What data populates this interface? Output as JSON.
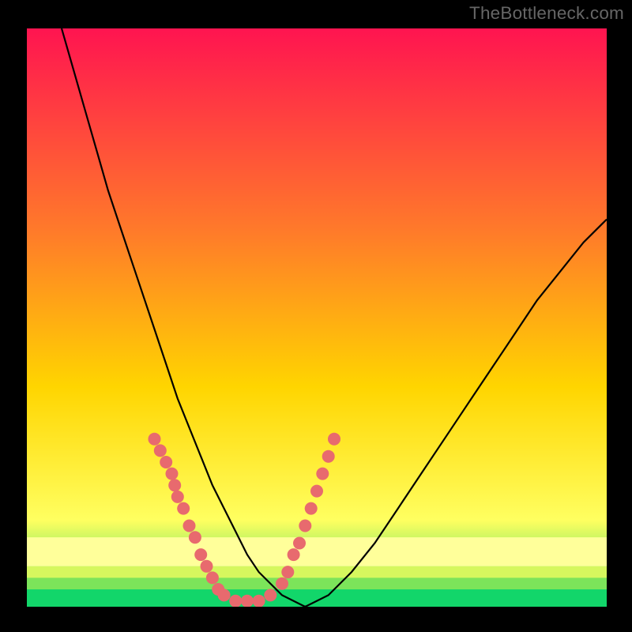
{
  "watermark": "TheBottleneck.com",
  "colors": {
    "gradient_top": "#ff1450",
    "gradient_mid1": "#ff7a2a",
    "gradient_mid2": "#ffd500",
    "gradient_mid3": "#ffff60",
    "gradient_bottom": "#12d66a",
    "curve": "#000000",
    "marker": "#e86a6e",
    "frame": "#000000"
  },
  "chart_data": {
    "type": "line",
    "title": "",
    "xlabel": "",
    "ylabel": "",
    "xlim": [
      0,
      100
    ],
    "ylim": [
      0,
      100
    ],
    "series": [
      {
        "name": "bottleneck-curve",
        "x": [
          6,
          8,
          10,
          12,
          14,
          16,
          18,
          20,
          22,
          24,
          26,
          28,
          30,
          32,
          34,
          36,
          38,
          40,
          44,
          48,
          52,
          56,
          60,
          64,
          68,
          72,
          76,
          80,
          84,
          88,
          92,
          96,
          100
        ],
        "y": [
          100,
          93,
          86,
          79,
          72,
          66,
          60,
          54,
          48,
          42,
          36,
          31,
          26,
          21,
          17,
          13,
          9,
          6,
          2,
          0,
          2,
          6,
          11,
          17,
          23,
          29,
          35,
          41,
          47,
          53,
          58,
          63,
          67
        ]
      }
    ],
    "markers": {
      "name": "dot-clusters",
      "points": [
        {
          "x": 22,
          "y": 29
        },
        {
          "x": 23,
          "y": 27
        },
        {
          "x": 24,
          "y": 25
        },
        {
          "x": 25,
          "y": 23
        },
        {
          "x": 25.5,
          "y": 21
        },
        {
          "x": 26,
          "y": 19
        },
        {
          "x": 27,
          "y": 17
        },
        {
          "x": 28,
          "y": 14
        },
        {
          "x": 29,
          "y": 12
        },
        {
          "x": 30,
          "y": 9
        },
        {
          "x": 31,
          "y": 7
        },
        {
          "x": 32,
          "y": 5
        },
        {
          "x": 33,
          "y": 3
        },
        {
          "x": 34,
          "y": 2
        },
        {
          "x": 36,
          "y": 1
        },
        {
          "x": 38,
          "y": 1
        },
        {
          "x": 40,
          "y": 1
        },
        {
          "x": 42,
          "y": 2
        },
        {
          "x": 44,
          "y": 4
        },
        {
          "x": 45,
          "y": 6
        },
        {
          "x": 46,
          "y": 9
        },
        {
          "x": 47,
          "y": 11
        },
        {
          "x": 48,
          "y": 14
        },
        {
          "x": 49,
          "y": 17
        },
        {
          "x": 50,
          "y": 20
        },
        {
          "x": 51,
          "y": 23
        },
        {
          "x": 52,
          "y": 26
        },
        {
          "x": 53,
          "y": 29
        }
      ]
    },
    "bottom_bands": [
      {
        "y0": 0,
        "y1": 3,
        "color": "#12d66a"
      },
      {
        "y0": 3,
        "y1": 5,
        "color": "#7ce45a"
      },
      {
        "y0": 5,
        "y1": 7,
        "color": "#d6f75e"
      },
      {
        "y0": 7,
        "y1": 12,
        "color": "#ffff9a"
      }
    ]
  }
}
